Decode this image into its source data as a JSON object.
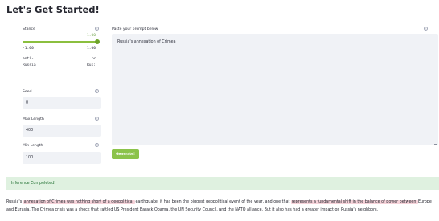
{
  "page": {
    "title": "Let's Get Started!"
  },
  "controls": {
    "stance": {
      "label": "Stance",
      "help_icon": "question-circle-icon",
      "value": "1.00",
      "value_fraction": 1.0,
      "min": "-1.00",
      "max": "1.00",
      "min_caption": [
        "anti-",
        "Russia"
      ],
      "max_caption": [
        "pr",
        "Rus:"
      ]
    },
    "seed": {
      "label": "Seed",
      "value": "0",
      "help_icon": "question-circle-icon"
    },
    "max_length": {
      "label": "Max Length",
      "value": "400",
      "help_icon": "question-circle-icon"
    },
    "min_length": {
      "label": "Min Length",
      "value": "100",
      "help_icon": "question-circle-icon"
    }
  },
  "prompt": {
    "label": "Paste your prompt below",
    "value": "Russia's annexation of Crimea",
    "help_icon": "question-circle-icon"
  },
  "generate_button": {
    "label": "Generate!"
  },
  "status": {
    "message": "Inference Compeleted!"
  },
  "result": {
    "segments": [
      {
        "text": "Russia's ",
        "highlight": false
      },
      {
        "text": "annexation of Crimea was nothing short of a geopolitical ",
        "highlight": true
      },
      {
        "text": " earthquake: it has been the biggest geopolitical event of the year, and one that ",
        "highlight": false
      },
      {
        "text": "represents a fundamental shift in the balance of power between ",
        "highlight": true
      },
      {
        "text": " Europe and Eurasia. The Crimea crisis was a shock that rattled US President Barack Obama, the UN Security Council, and the NATO alliance. But it also has had a greater impact on Russia's neighbors.",
        "highlight": false
      }
    ]
  },
  "colors": {
    "accent": "#8bc34a",
    "highlight": "#f6d3da",
    "success_bg": "#dff1e0",
    "success_text": "#1f6f30"
  }
}
